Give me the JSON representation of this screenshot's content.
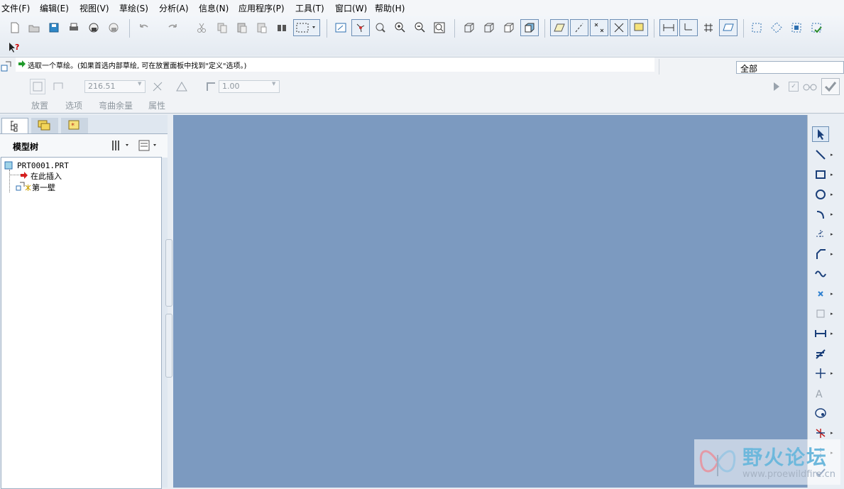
{
  "menubar": {
    "items": [
      "文件(F)",
      "编辑(E)",
      "视图(V)",
      "草绘(S)",
      "分析(A)",
      "信息(N)",
      "应用程序(P)",
      "工具(T)",
      "窗口(W)",
      "帮助(H)"
    ]
  },
  "dashboard": {
    "message": "选取一个草绘。(如果首选内部草绘, 可在放置面板中找到\"定义\"选项。)",
    "filter_value": "全部",
    "thickness_value": "216.51",
    "bend_value": "1.00",
    "tabs": [
      "放置",
      "选项",
      "弯曲余量",
      "属性"
    ]
  },
  "model_tree": {
    "title": "模型树",
    "items": [
      "PRT0001.PRT",
      "在此插入",
      "第一壁"
    ]
  },
  "watermark": {
    "title": "野火论坛",
    "url": "www.proewildfire.cn"
  },
  "colors": {
    "graphics_background": "#7c9ac0",
    "toolbar_background": "#e9eef4"
  }
}
